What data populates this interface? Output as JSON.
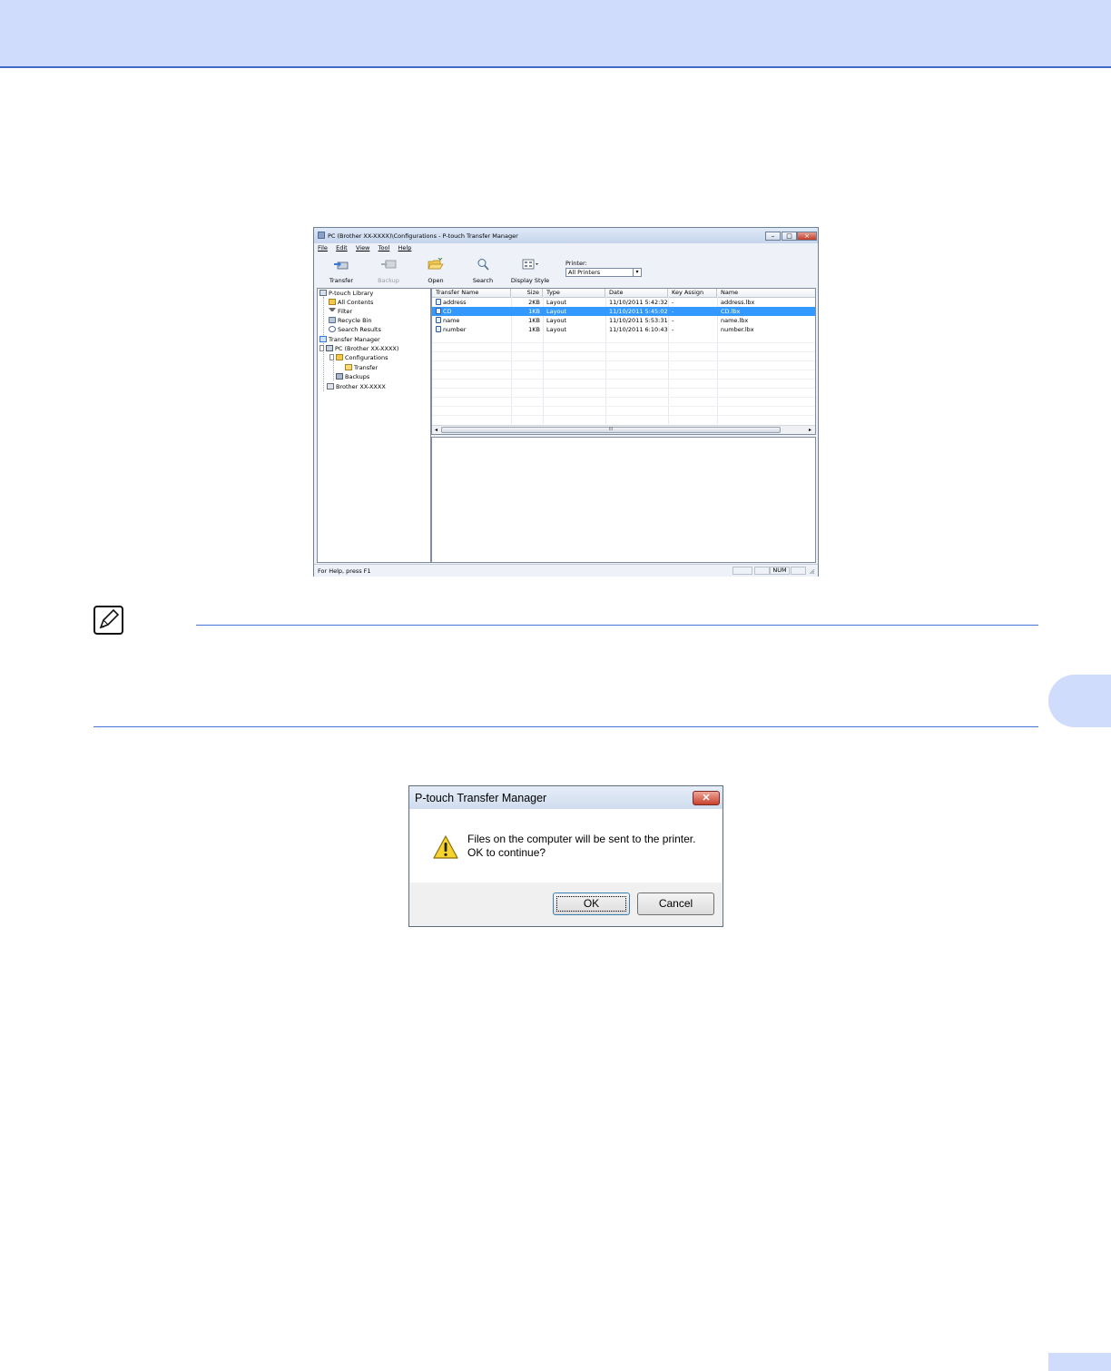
{
  "window": {
    "title": "PC (Brother XX-XXXX)\\Configurations - P-touch Transfer Manager",
    "menu": [
      "File",
      "Edit",
      "View",
      "Tool",
      "Help"
    ],
    "toolbar": {
      "transfer": "Transfer",
      "backup": "Backup",
      "open": "Open",
      "search": "Search",
      "display_style": "Display Style",
      "printer_label": "Printer:",
      "printer_value": "All Printers"
    },
    "tree": {
      "library": "P-touch Library",
      "all_contents": "All Contents",
      "filter": "Filter",
      "recycle_bin": "Recycle Bin",
      "search_results": "Search Results",
      "transfer_manager": "Transfer Manager",
      "pc": "PC (Brother XX-XXXX)",
      "configurations": "Configurations",
      "transfer": "Transfer",
      "backups": "Backups",
      "printer": "Brother XX-XXXX"
    },
    "columns": [
      "Transfer Name",
      "Size",
      "Type",
      "Date",
      "Key Assign",
      "Name"
    ],
    "rows": [
      {
        "name": "address",
        "size": "2KB",
        "type": "Layout",
        "date": "11/10/2011 5:42:32...",
        "key": "-",
        "file": "address.lbx"
      },
      {
        "name": "CD",
        "size": "1KB",
        "type": "Layout",
        "date": "11/10/2011 5:45:02...",
        "key": "-",
        "file": "CD.lbx"
      },
      {
        "name": "name",
        "size": "1KB",
        "type": "Layout",
        "date": "11/10/2011 5:53:31...",
        "key": "-",
        "file": "name.lbx"
      },
      {
        "name": "number",
        "size": "1KB",
        "type": "Layout",
        "date": "11/10/2011 6:10:43...",
        "key": "-",
        "file": "number.lbx"
      }
    ],
    "scroll_grip": "III",
    "status_text": "For Help, press F1",
    "status_num": "NUM"
  },
  "dialog": {
    "title": "P-touch Transfer Manager",
    "close_glyph": "✕",
    "message_line1": "Files on the computer will be sent to the printer.",
    "message_line2": "OK to continue?",
    "ok": "OK",
    "cancel": "Cancel"
  },
  "colors": {
    "header_band": "#cfdcfc",
    "accent_line": "#4a74d4",
    "selection": "#3399ff"
  }
}
